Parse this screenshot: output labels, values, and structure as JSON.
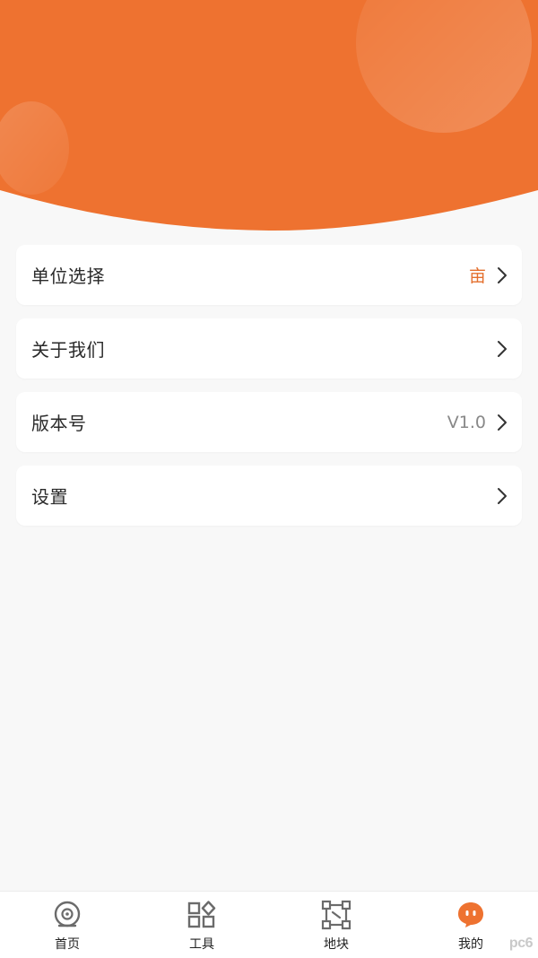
{
  "colors": {
    "accent": "#ee7230",
    "accent_text": "#e46f2d",
    "background": "#f8f8f8",
    "card": "#ffffff",
    "icon_gray": "#6b6b6b"
  },
  "menu": {
    "items": [
      {
        "label": "单位选择",
        "value": "亩",
        "icon": "chevron-right-icon"
      },
      {
        "label": "关于我们",
        "value": "",
        "icon": "chevron-right-icon"
      },
      {
        "label": "版本号",
        "value": "V1.0",
        "icon": "chevron-right-icon"
      },
      {
        "label": "设置",
        "value": "",
        "icon": "chevron-right-icon"
      }
    ]
  },
  "tabbar": {
    "tabs": [
      {
        "label": "首页",
        "icon": "home-disc-icon",
        "active": false
      },
      {
        "label": "工具",
        "icon": "tools-grid-icon",
        "active": false
      },
      {
        "label": "地块",
        "icon": "land-plot-icon",
        "active": false
      },
      {
        "label": "我的",
        "icon": "profile-face-icon",
        "active": true
      }
    ]
  },
  "watermark": "pc6"
}
